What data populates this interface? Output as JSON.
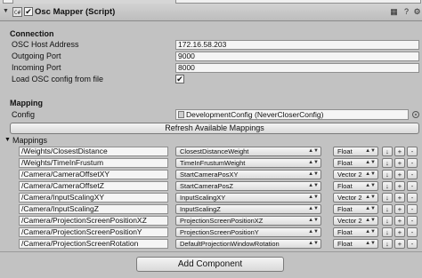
{
  "header": {
    "fold_icon": "triangle-down",
    "script_icon": "cs-script-icon",
    "enabled": true,
    "title": "Osc Mapper (Script)",
    "icons": [
      "book-icon",
      "gear-icon"
    ]
  },
  "connection": {
    "heading": "Connection",
    "fields": [
      {
        "label": "OSC Host Address",
        "value": "172.16.58.203"
      },
      {
        "label": "Outgoing Port",
        "value": "9000"
      },
      {
        "label": "Incoming Port",
        "value": "8000"
      }
    ],
    "load_config": {
      "label": "Load OSC config from file",
      "checked": true,
      "mark": "✔"
    }
  },
  "mapping": {
    "heading": "Mapping",
    "config_label": "Config",
    "config_value": "DevelopmentConfig (NeverCloserConfig)",
    "refresh_label": "Refresh Available Mappings"
  },
  "mappings": {
    "label": "Mappings",
    "down_label": "↓",
    "add_label": "+",
    "remove_label": "-",
    "rows": [
      {
        "path": "/Weights/ClosestDistance",
        "property": "ClosestDistanceWeight",
        "type": "Float"
      },
      {
        "path": "/Weights/TimeInFrustum",
        "property": "TimeInFrustumWeight",
        "type": "Float"
      },
      {
        "path": "/Camera/CameraOffsetXY",
        "property": "StartCameraPosXY",
        "type": "Vector 2"
      },
      {
        "path": "/Camera/CameraOffsetZ",
        "property": "StartCameraPosZ",
        "type": "Float"
      },
      {
        "path": "/Camera/InputScalingXY",
        "property": "InputScalingXY",
        "type": "Vector 2"
      },
      {
        "path": "/Camera/InputScalingZ",
        "property": "InputScalingZ",
        "type": "Float"
      },
      {
        "path": "/Camera/ProjectionScreenPositionXZ",
        "property": "ProjectionScreenPositionXZ",
        "type": "Vector 2"
      },
      {
        "path": "/Camera/ProjectionScreenPositionY",
        "property": "ProjectionScreenPositionY",
        "type": "Float"
      },
      {
        "path": "/Camera/ProjectionScreenRotation",
        "property": "DefaultProjectionWindowRotation",
        "type": "Float"
      }
    ]
  },
  "footer": {
    "add_component_label": "Add Component"
  },
  "colors": {
    "background": "#c2c2c2",
    "field": "#f5f5f5",
    "border": "#8f8f8f"
  }
}
